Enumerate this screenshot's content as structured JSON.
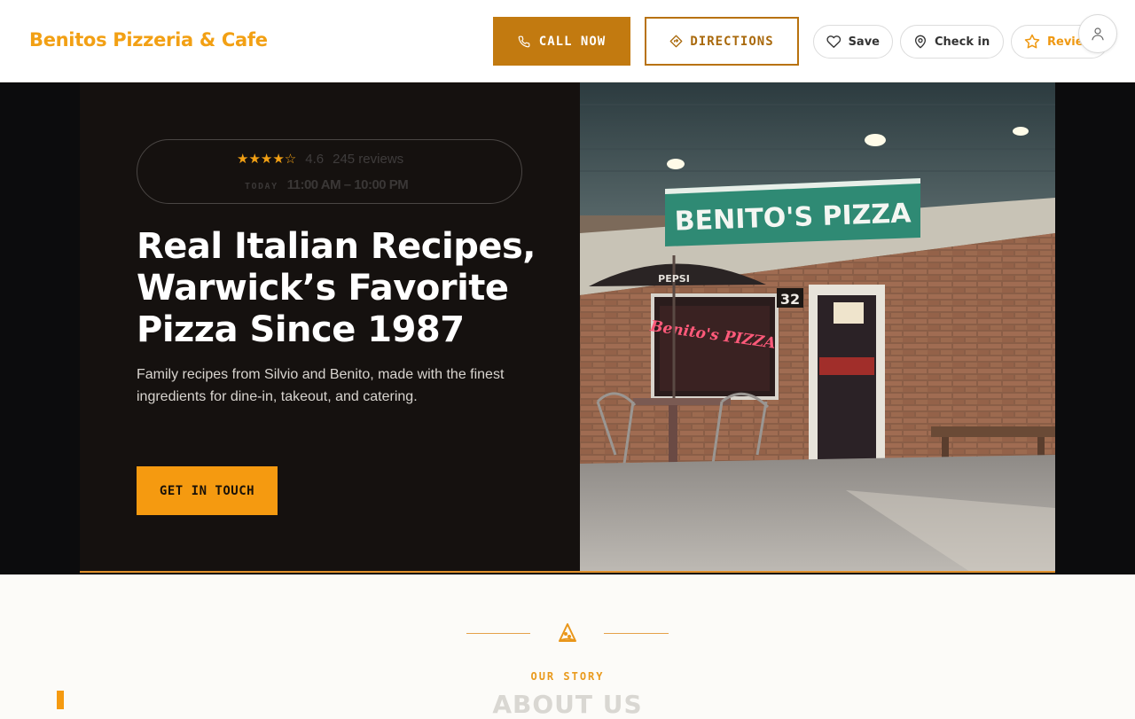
{
  "header": {
    "brand": "Benitos Pizzeria & Cafe",
    "call_label": "CALL NOW",
    "directions_label": "DIRECTIONS",
    "save_label": "Save",
    "checkin_label": "Check in",
    "review_label": "Review"
  },
  "hero": {
    "stars": "★★★★☆",
    "rating": "4.6",
    "review_count": "245 reviews",
    "hours_label": "TODAY",
    "hours_value": "11:00 AM – 10:00 PM",
    "title_line1": "Real Italian Recipes,",
    "title_line2": "Warwick’s Favorite",
    "title_line3": "Pizza Since 1987",
    "subtitle": "Family recipes from Silvio and Benito, made with the finest ingredients for dine-in, takeout, and catering.",
    "cta_label": "GET IN TOUCH",
    "sign_text": "BENITO'S PIZZA",
    "neon_text": "Benito's PIZZA",
    "address_number": "32",
    "umbrella_text": "PEPSI"
  },
  "story": {
    "label": "OUR STORY",
    "title": "ABOUT US"
  },
  "colors": {
    "accent": "#f59a10",
    "brand": "#f2a014",
    "call_bg": "#c27a10",
    "hero_bg": "#15110f"
  },
  "icons": [
    "phone-icon",
    "directions-icon",
    "heart-icon",
    "map-pin-icon",
    "star-icon",
    "user-icon",
    "pizza-slice-icon"
  ]
}
